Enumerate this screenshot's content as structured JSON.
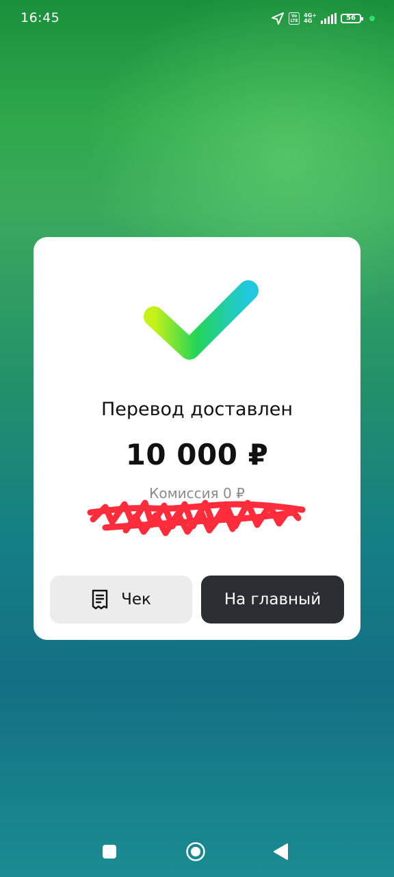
{
  "status_bar": {
    "time": "16:45",
    "volte_label": "Vo LTE",
    "network_top": "4G+",
    "network_bottom": "4G",
    "battery_level": "56",
    "icons": [
      "location-arrow-icon",
      "volte-icon",
      "signal-icon",
      "battery-icon",
      "green-dot-icon"
    ]
  },
  "card": {
    "icon": "checkmark-icon",
    "title": "Перевод доставлен",
    "amount": "10 000 ₽",
    "fee": "Комиссия 0 ₽",
    "receipt_button": {
      "label": "Чек",
      "icon": "receipt-icon"
    },
    "home_button": {
      "label": "На главный"
    }
  },
  "nav_bar": {
    "icons": [
      "recent-apps-icon",
      "home-icon",
      "back-icon"
    ]
  },
  "colors": {
    "card_bg": "#ffffff",
    "home_button_bg": "#2b2f33",
    "receipt_button_bg": "#ececec",
    "scribble": "#ff2232",
    "check_gradient_start": "#c6f21a",
    "check_gradient_mid": "#24d456",
    "check_gradient_end": "#20c8e0"
  }
}
